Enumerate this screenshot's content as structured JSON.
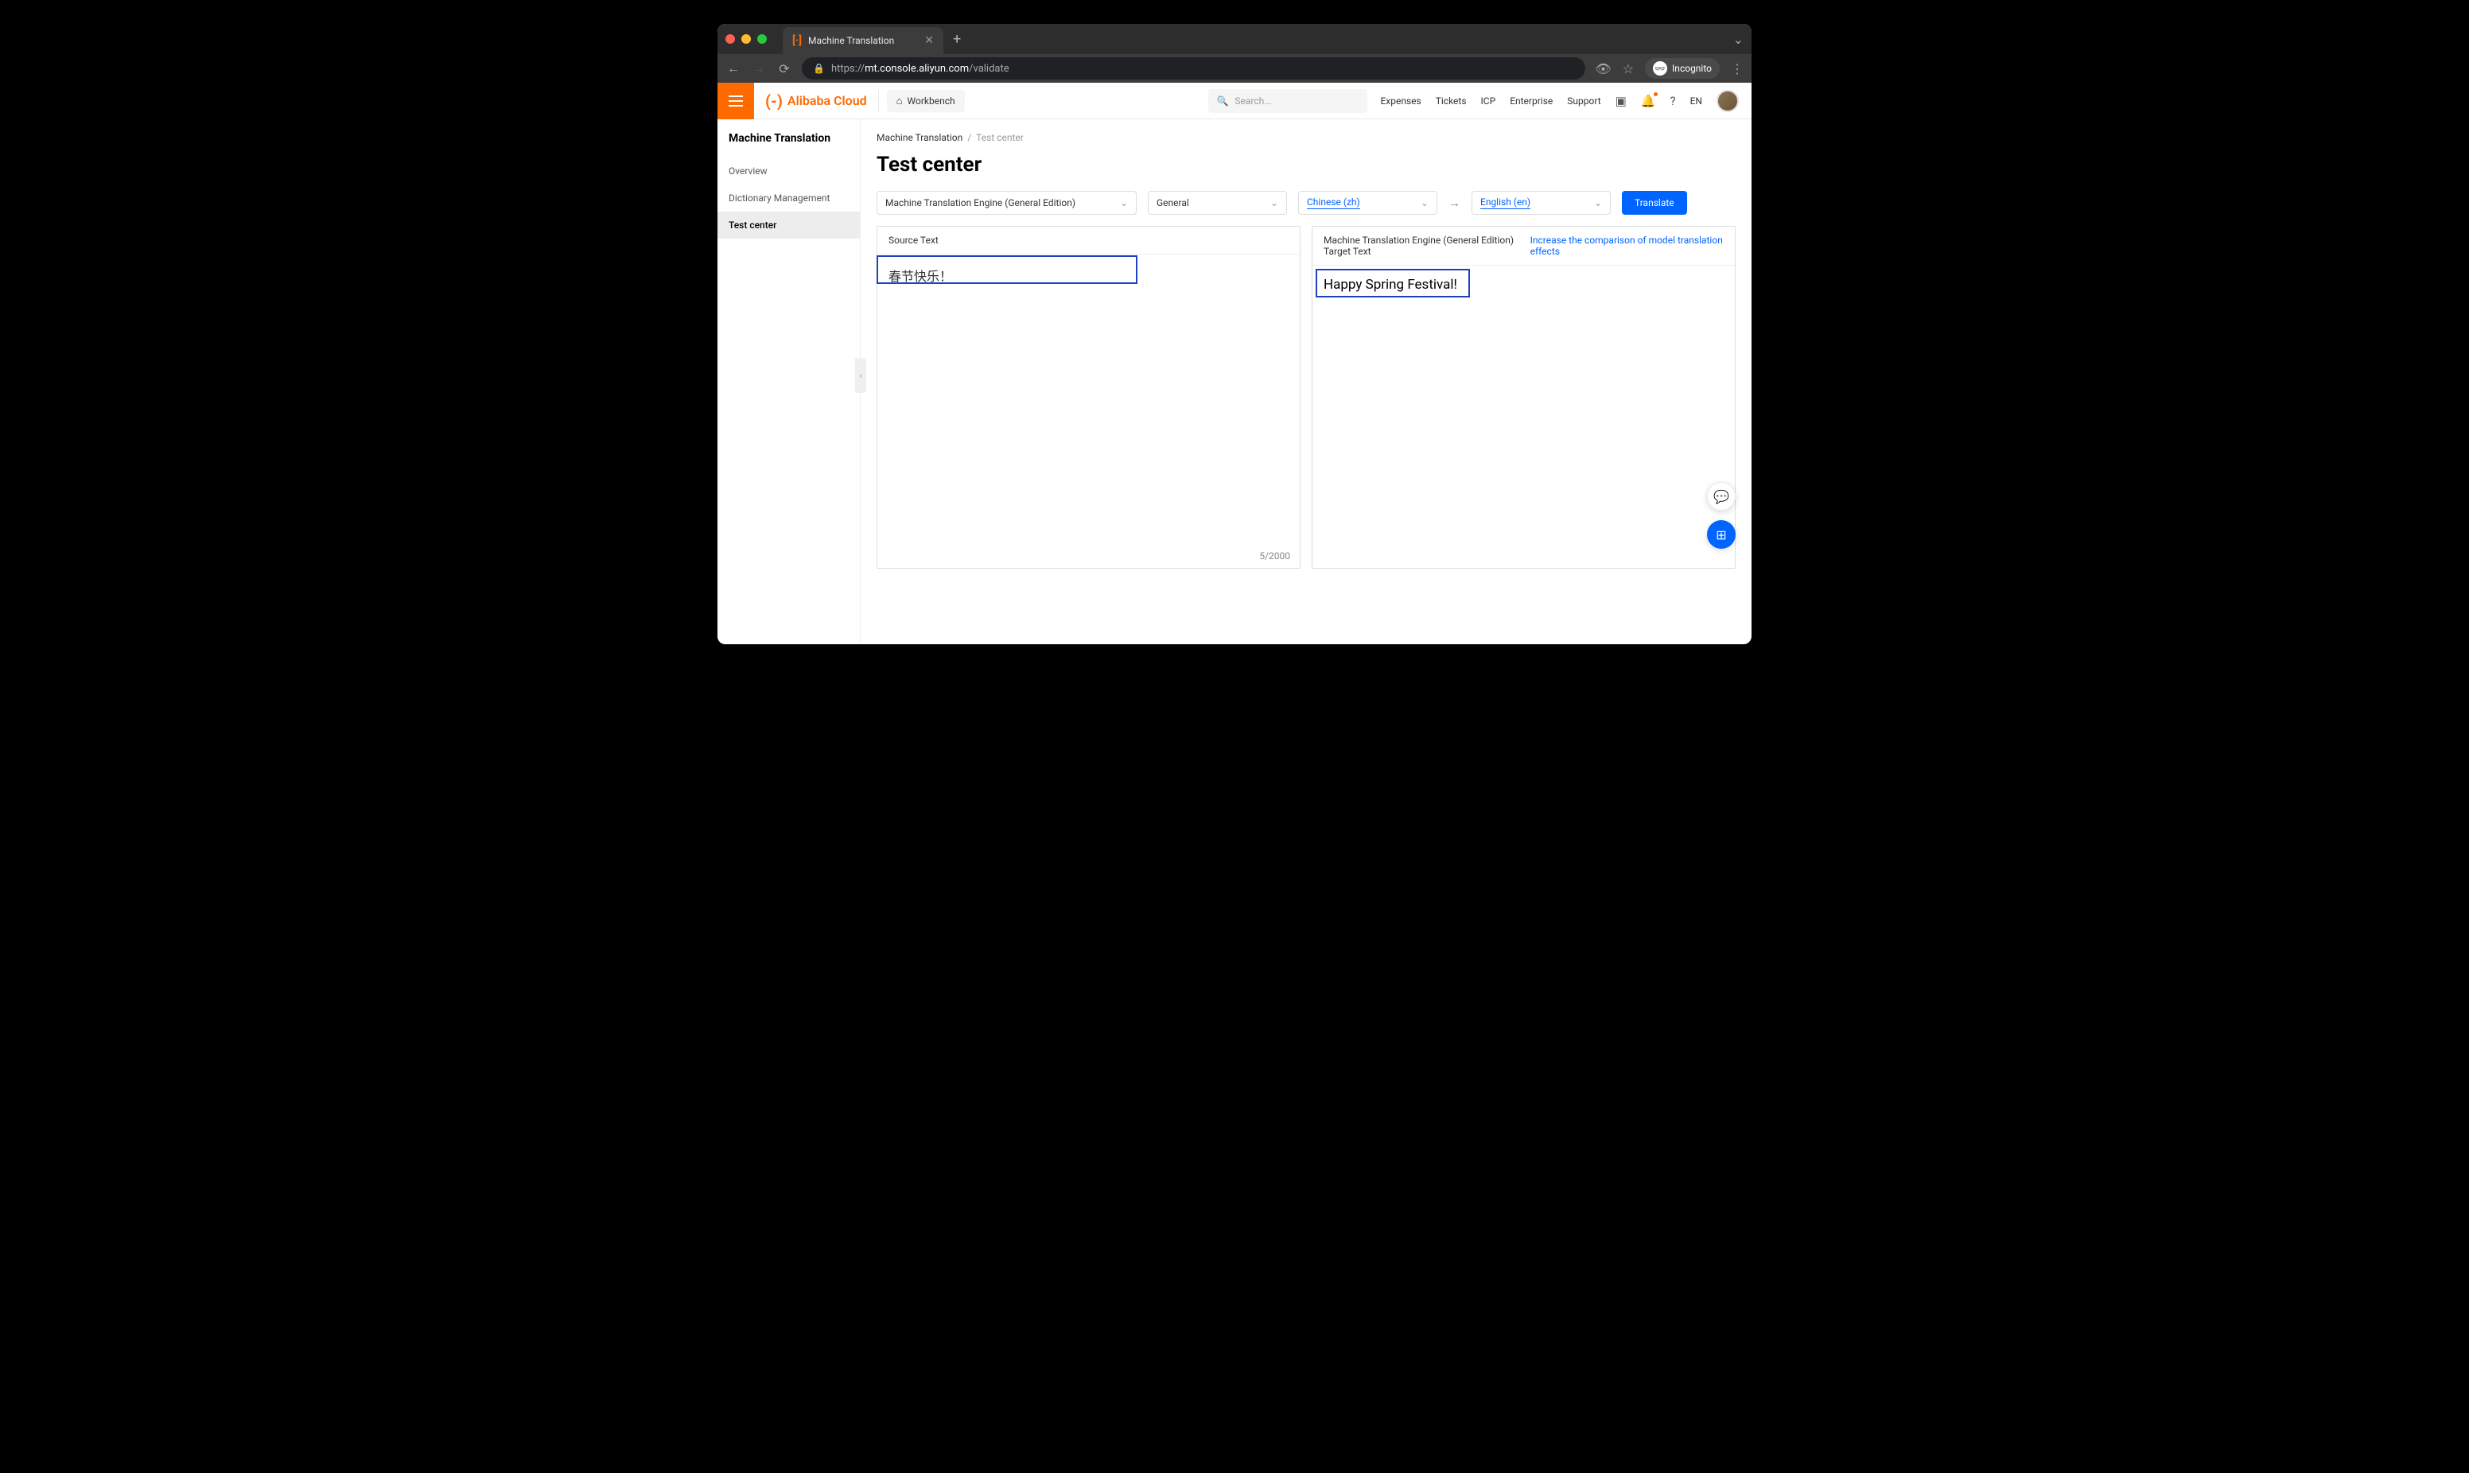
{
  "browser": {
    "tab_title": "Machine Translation",
    "url_prefix": "https://",
    "url_domain": "mt.console.aliyun.com",
    "url_path": "/validate",
    "incognito_label": "Incognito"
  },
  "header": {
    "brand": "Alibaba Cloud",
    "workbench": "Workbench",
    "search_placeholder": "Search...",
    "links": {
      "expenses": "Expenses",
      "tickets": "Tickets",
      "icp": "ICP",
      "enterprise": "Enterprise",
      "support": "Support",
      "lang": "EN"
    }
  },
  "sidebar": {
    "title": "Machine Translation",
    "items": [
      {
        "label": "Overview"
      },
      {
        "label": "Dictionary Management"
      },
      {
        "label": "Test center"
      }
    ]
  },
  "breadcrumb": {
    "root": "Machine Translation",
    "sep": "/",
    "current": "Test center"
  },
  "page": {
    "title": "Test center"
  },
  "controls": {
    "engine": "Machine Translation Engine (General Edition)",
    "domain": "General",
    "source_lang": "Chinese (zh)",
    "target_lang": "English (en)",
    "translate_button": "Translate"
  },
  "panels": {
    "source_header": "Source Text",
    "target_header": "Machine Translation Engine (General Edition) Target Text",
    "compare_link": "Increase the comparison of model translation effects",
    "source_text": "春节快乐！",
    "target_text": "Happy Spring Festival!",
    "char_count": "5/2000"
  }
}
